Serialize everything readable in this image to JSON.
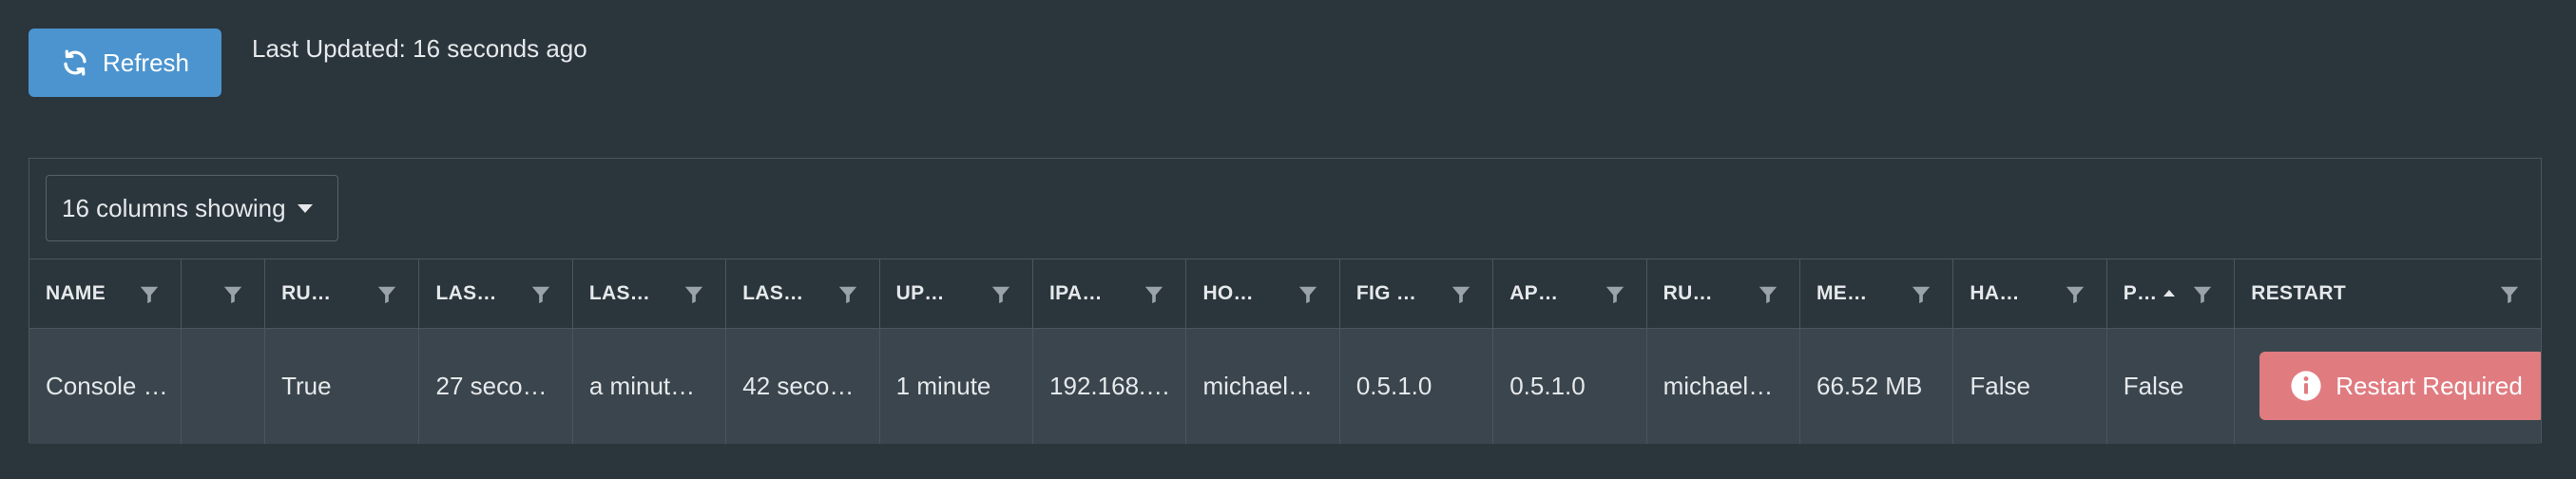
{
  "toolbar": {
    "refresh_label": "Refresh",
    "last_updated": "Last Updated: 16 seconds ago"
  },
  "columns_select": {
    "label": "16 columns showing"
  },
  "table": {
    "headers": [
      "NAME",
      "",
      "RU…",
      "LAS…",
      "LAS…",
      "LAS…",
      "UP…",
      "IPA…",
      "HO…",
      "FIG …",
      "AP…",
      "RU…",
      "ME…",
      "HA…",
      "P…",
      "RESTART"
    ],
    "row": [
      "Console …",
      "",
      "True",
      "27 seco…",
      "a minut…",
      "42 seco…",
      "1 minute",
      "192.168.…",
      "michael…",
      "0.5.1.0",
      "0.5.1.0",
      "michael…",
      "66.52 MB",
      "False",
      "False"
    ],
    "restart_label": "Restart Required",
    "sorted_column": "P…",
    "sort_direction": "ascending"
  },
  "colors": {
    "background": "#2b353c",
    "row_background": "#3a454d",
    "refresh_button": "#4b94cf",
    "restart_button": "#e07b80"
  },
  "icons": {
    "refresh": "refresh-icon",
    "filter": "filter-icon",
    "info": "info-icon",
    "caret": "caret-down-icon",
    "sort": "sort-ascending-icon"
  }
}
